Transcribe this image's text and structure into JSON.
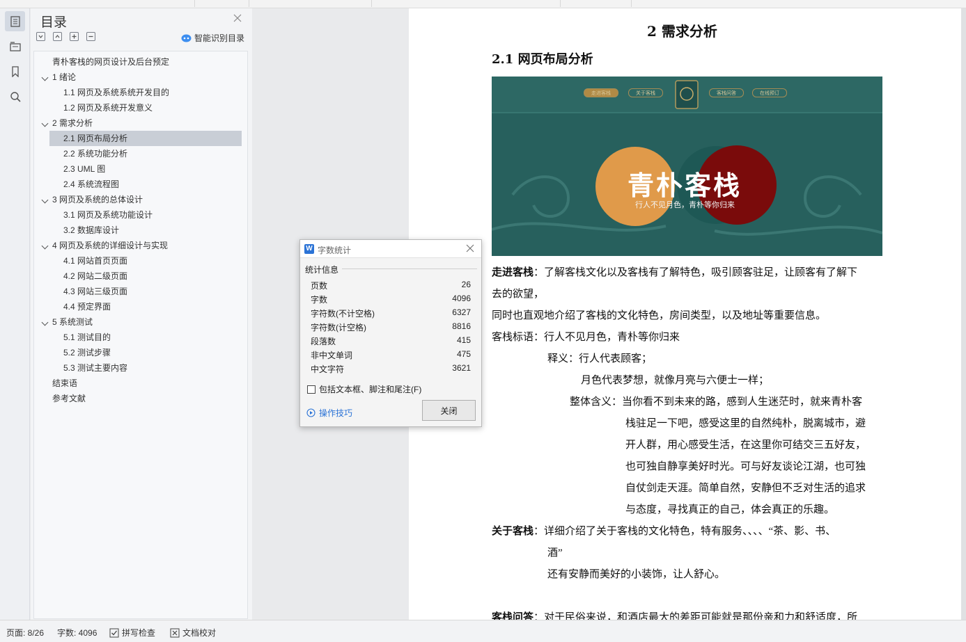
{
  "toc": {
    "title": "目录",
    "smart_label": "智能识别目录",
    "items": [
      {
        "label": "青朴客栈的网页设计及后台预定",
        "level": 0,
        "expandable": false,
        "selected": false
      },
      {
        "label": "1  绪论",
        "level": 1,
        "expandable": true,
        "selected": false
      },
      {
        "label": "1.1 网页及系统系统开发目的",
        "level": 2,
        "expandable": false,
        "selected": false
      },
      {
        "label": "1.2 网页及系统开发意义",
        "level": 2,
        "expandable": false,
        "selected": false
      },
      {
        "label": "2  需求分析",
        "level": 1,
        "expandable": true,
        "selected": false
      },
      {
        "label": "2.1  网页布局分析",
        "level": 2,
        "expandable": false,
        "selected": true
      },
      {
        "label": "2.2  系统功能分析",
        "level": 2,
        "expandable": false,
        "selected": false
      },
      {
        "label": "2.3 UML 图",
        "level": 2,
        "expandable": false,
        "selected": false
      },
      {
        "label": "2.4  系统流程图",
        "level": 2,
        "expandable": false,
        "selected": false
      },
      {
        "label": "3  网页及系统的总体设计",
        "level": 1,
        "expandable": true,
        "selected": false
      },
      {
        "label": "3.1  网页及系统功能设计",
        "level": 2,
        "expandable": false,
        "selected": false
      },
      {
        "label": "3.2  数据库设计",
        "level": 2,
        "expandable": false,
        "selected": false
      },
      {
        "label": "4  网页及系统的详细设计与实现",
        "level": 1,
        "expandable": true,
        "selected": false
      },
      {
        "label": "4.1  网站首页页面",
        "level": 2,
        "expandable": false,
        "selected": false
      },
      {
        "label": "4.2  网站二级页面",
        "level": 2,
        "expandable": false,
        "selected": false
      },
      {
        "label": "4.3  网站三级页面",
        "level": 2,
        "expandable": false,
        "selected": false
      },
      {
        "label": "4.4  预定界面",
        "level": 2,
        "expandable": false,
        "selected": false
      },
      {
        "label": "5  系统测试",
        "level": 1,
        "expandable": true,
        "selected": false
      },
      {
        "label": "5.1  测试目的",
        "level": 2,
        "expandable": false,
        "selected": false
      },
      {
        "label": "5.2  测试步骤",
        "level": 2,
        "expandable": false,
        "selected": false
      },
      {
        "label": "5.3  测试主要内容",
        "level": 2,
        "expandable": false,
        "selected": false
      },
      {
        "label": "结束语",
        "level": 0,
        "expandable": false,
        "selected": false
      },
      {
        "label": "参考文献",
        "level": 0,
        "expandable": false,
        "selected": false
      }
    ]
  },
  "doc": {
    "chapter_title": "2  需求分析",
    "section_title": "2.1  网页布局分析",
    "banner": {
      "title": "青朴客栈",
      "subtitle": "行人不见月色，青朴等你归来",
      "nav": [
        "走进客栈",
        "关于客栈",
        "客栈问答",
        "在线预订"
      ],
      "colors": {
        "bg": "#27605d",
        "orange": "#e09a4a",
        "red": "#7a0b0b"
      }
    },
    "lines": [
      {
        "bold": "走进客栈",
        "text": "：了解客栈文化以及客栈有了解特色，吸引顾客驻足，让顾客有了解下"
      },
      {
        "bold": "",
        "text": "去的欲望，"
      },
      {
        "bold": "",
        "text": "同时也直观地介绍了客栈的文化特色，房间类型，以及地址等重要信息。"
      },
      {
        "bold": "",
        "text": "客栈标语：行人不见月色，青朴等你归来"
      },
      {
        "bold": "",
        "text": "释义：行人代表顾客；"
      },
      {
        "bold": "",
        "text": "月色代表梦想，就像月亮与六便士一样；"
      },
      {
        "bold": "",
        "text": "整体含义：当你看不到未来的路，感到人生迷茫时，就来青朴客"
      },
      {
        "bold": "",
        "text": "栈驻足一下吧，感受这里的自然纯朴，脱离城市，避"
      },
      {
        "bold": "",
        "text": "开人群，用心感受生活，在这里你可结交三五好友，"
      },
      {
        "bold": "",
        "text": "也可独自静享美好时光。可与好友谈论江湖，也可独"
      },
      {
        "bold": "",
        "text": "自仗剑走天涯。简单自然，安静但不乏对生活的追求"
      },
      {
        "bold": "",
        "text": "与态度，寻找真正的自己，体会真正的乐趣。"
      },
      {
        "bold": "关于客栈",
        "text": "：详细介绍了关于客栈的文化特色，特有服务、、、、“茶、影、书、"
      },
      {
        "bold": "",
        "text": "酒”"
      },
      {
        "bold": "",
        "text": "还有安静而美好的小装饰，让人舒心。"
      },
      {
        "bold": "客栈问答",
        "text": "：对于民俗来说，和酒店最大的差距可能就是那份亲和力和舒适度，所"
      }
    ]
  },
  "dialog": {
    "title": "字数统计",
    "section": "统计信息",
    "stats": [
      {
        "label": "页数",
        "value": "26"
      },
      {
        "label": "字数",
        "value": "4096"
      },
      {
        "label": "字符数(不计空格)",
        "value": "6327"
      },
      {
        "label": "字符数(计空格)",
        "value": "8816"
      },
      {
        "label": "段落数",
        "value": "415"
      },
      {
        "label": "非中文单词",
        "value": "475"
      },
      {
        "label": "中文字符",
        "value": "3621"
      }
    ],
    "checkbox_label": "包括文本框、脚注和尾注(F)",
    "tips_label": "操作技巧",
    "close_label": "关闭"
  },
  "status": {
    "page": "页面: 8/26",
    "words": "字数: 4096",
    "spell": "拼写检查",
    "proof": "文档校对"
  }
}
